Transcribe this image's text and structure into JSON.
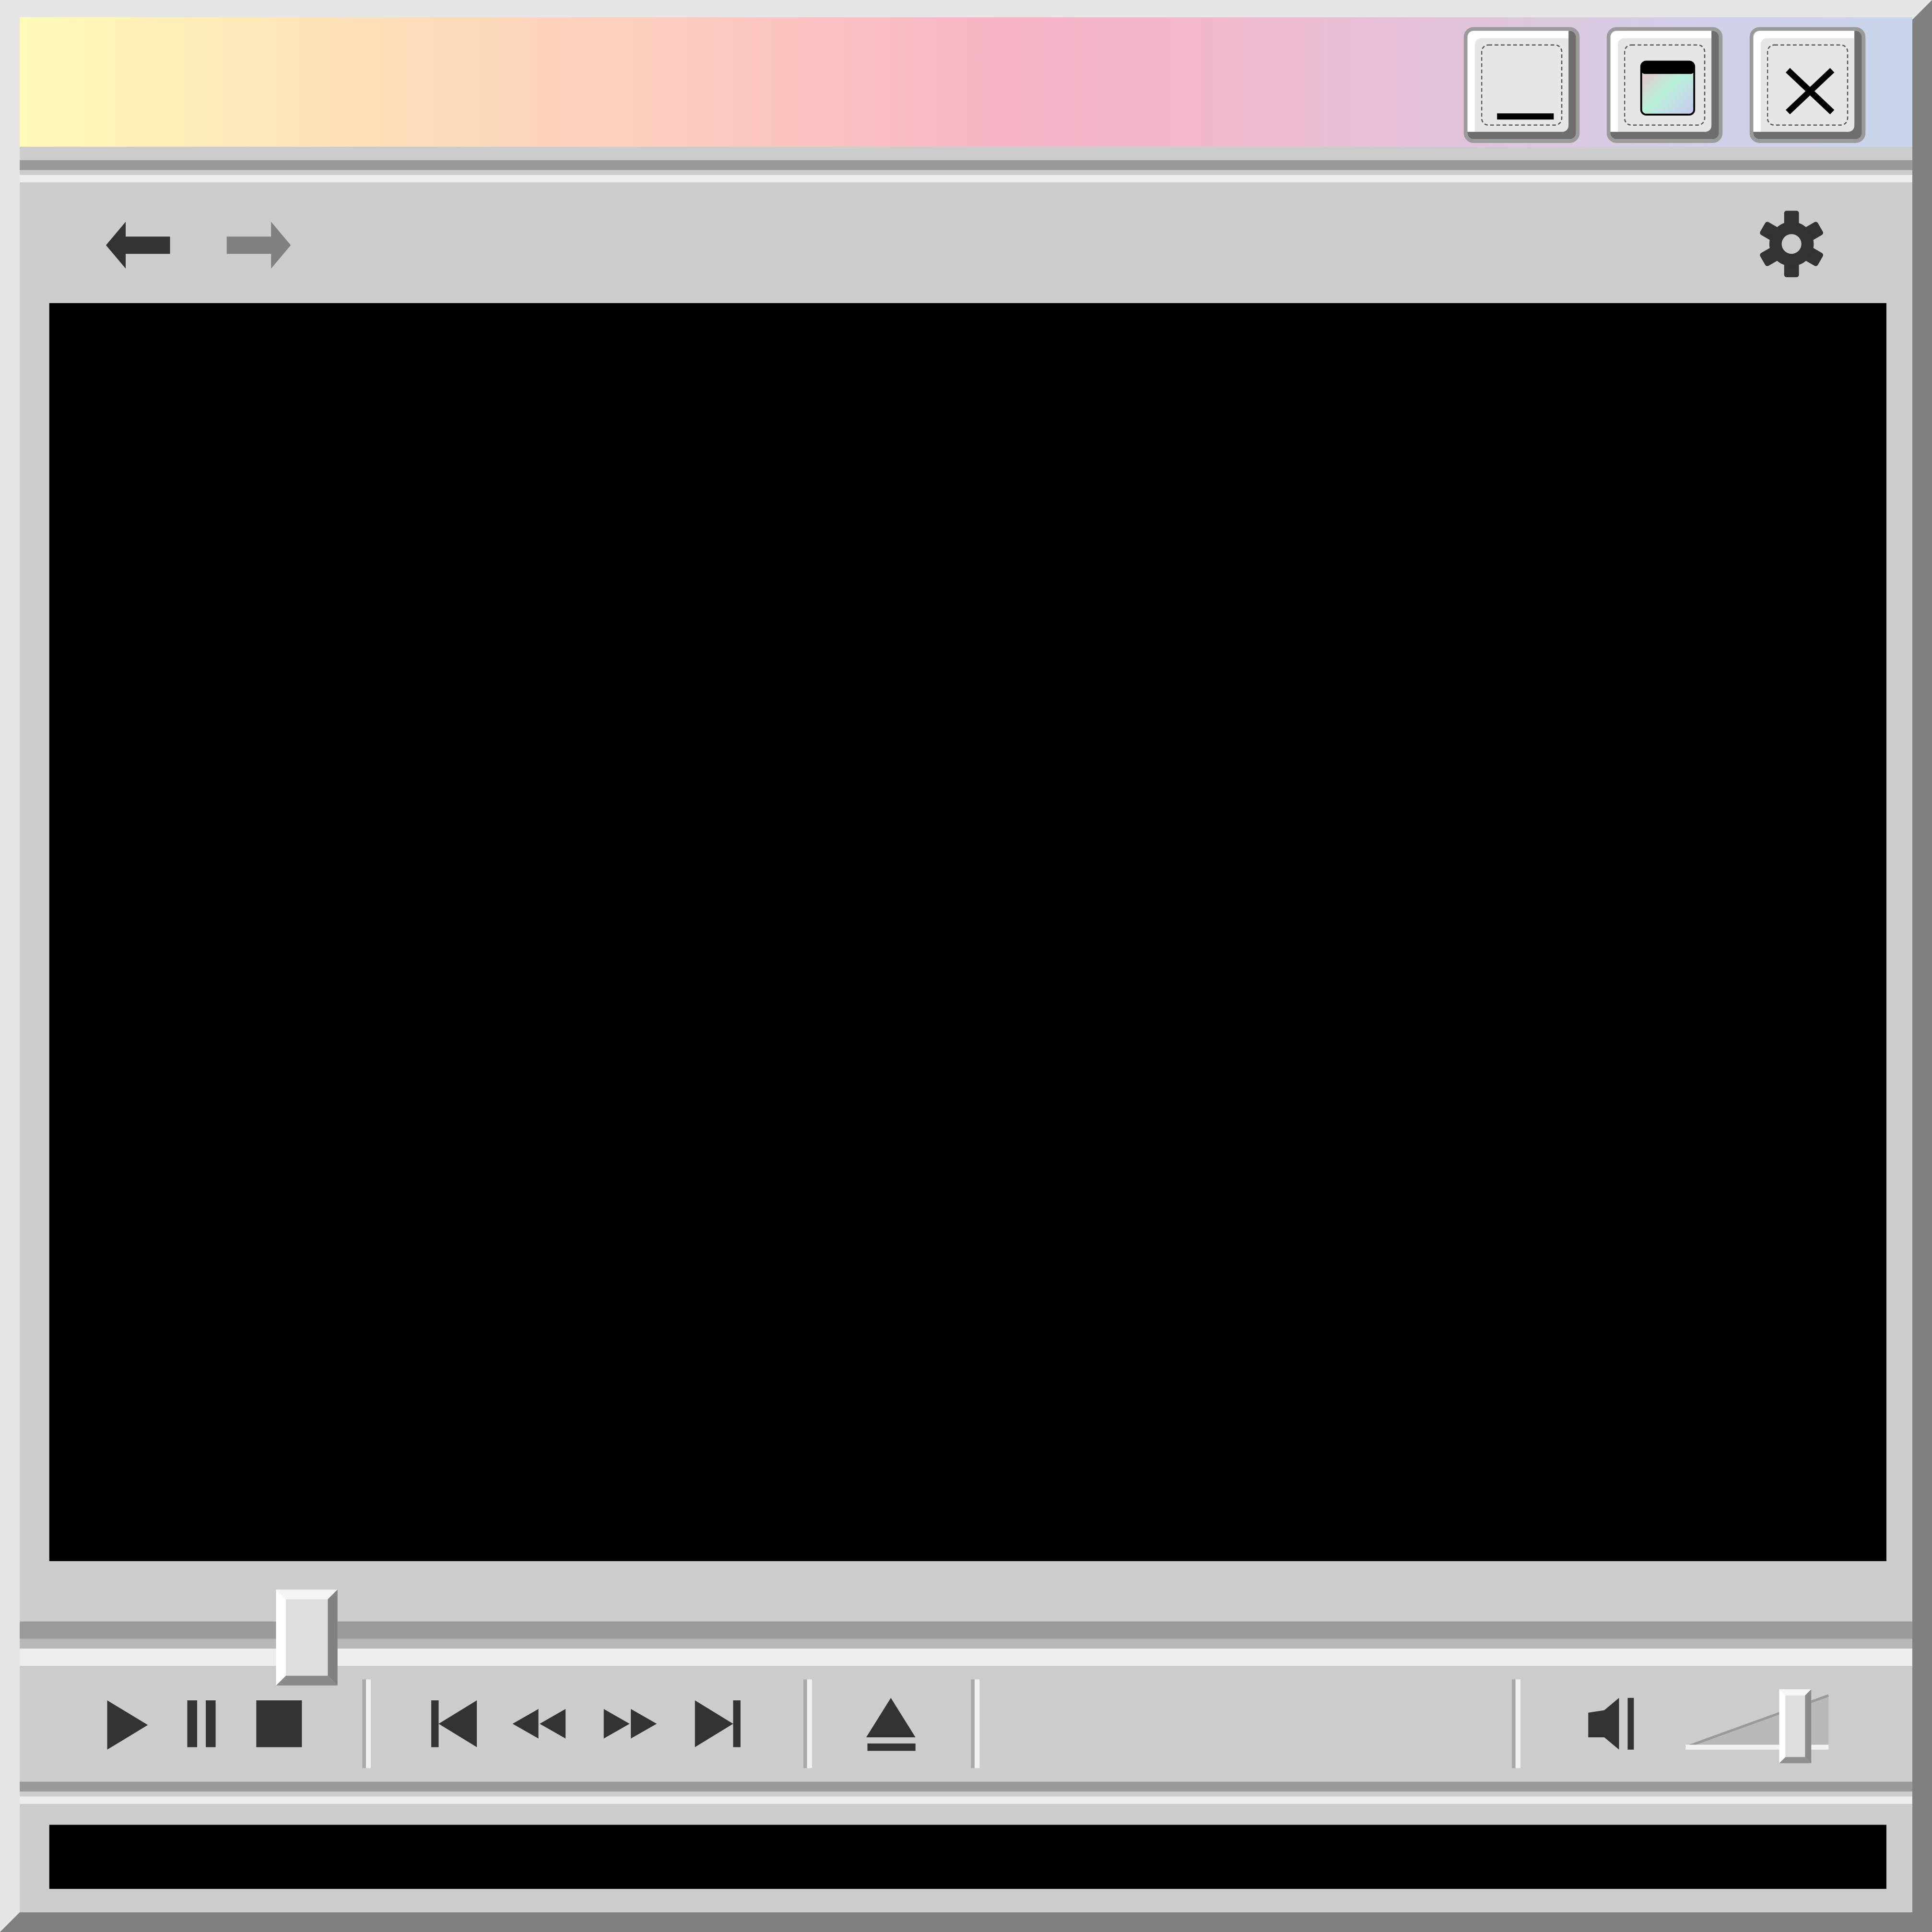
{
  "window": {
    "title": "",
    "buttons": {
      "minimize": "minimize",
      "maximize": "maximize",
      "close": "close"
    }
  },
  "colors": {
    "frame": "#e6e6e6",
    "panel": "#cccccc",
    "icon": "#333333",
    "icon_disabled": "#808080",
    "screen": "#000000"
  },
  "navigation": {
    "back_icon": "arrow-left-icon",
    "forward_icon": "arrow-right-icon",
    "settings_icon": "gear-icon"
  },
  "playback": {
    "progress": 0.14,
    "volume": 0.75,
    "controls": [
      "play-icon",
      "pause-icon",
      "stop-icon",
      "skip-back-icon",
      "rewind-icon",
      "fast-forward-icon",
      "skip-forward-icon",
      "eject-icon",
      "speaker-icon"
    ]
  },
  "status": {
    "text": ""
  }
}
